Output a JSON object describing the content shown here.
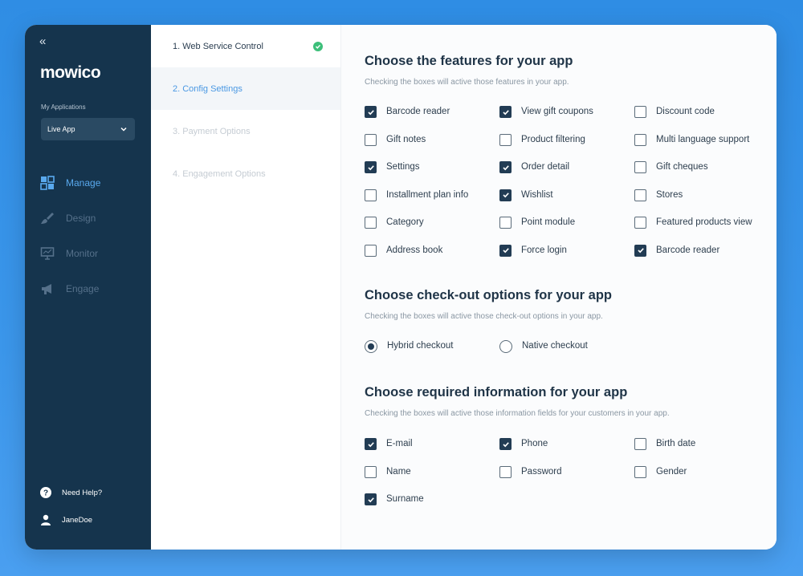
{
  "sidebar": {
    "collapse_glyph": "«",
    "logo": "mowico",
    "apps_label": "My Applications",
    "selected_app": "Live App",
    "nav": [
      {
        "label": "Manage",
        "icon": "grid-icon",
        "active": true
      },
      {
        "label": "Design",
        "icon": "brush-icon",
        "active": false
      },
      {
        "label": "Monitor",
        "icon": "monitor-icon",
        "active": false
      },
      {
        "label": "Engage",
        "icon": "megaphone-icon",
        "active": false
      }
    ],
    "help": "Need Help?",
    "user": "JaneDoe"
  },
  "steps": [
    {
      "label": "1. Web Service Control",
      "state": "done"
    },
    {
      "label": "2. Config Settings",
      "state": "active"
    },
    {
      "label": "3. Payment Options",
      "state": "pending"
    },
    {
      "label": "4. Engagement Options",
      "state": "pending"
    }
  ],
  "features": {
    "title": "Choose the features for your app",
    "subtitle": "Checking the boxes will active those features in your app.",
    "options": [
      {
        "label": "Barcode reader",
        "checked": true
      },
      {
        "label": "View gift coupons",
        "checked": true
      },
      {
        "label": "Discount code",
        "checked": false
      },
      {
        "label": "Gift notes",
        "checked": false
      },
      {
        "label": "Product filtering",
        "checked": false
      },
      {
        "label": "Multi language support",
        "checked": false
      },
      {
        "label": "Settings",
        "checked": true
      },
      {
        "label": "Order detail",
        "checked": true
      },
      {
        "label": "Gift cheques",
        "checked": false
      },
      {
        "label": "Installment plan info",
        "checked": false
      },
      {
        "label": "Wishlist",
        "checked": true
      },
      {
        "label": "Stores",
        "checked": false
      },
      {
        "label": "Category",
        "checked": false
      },
      {
        "label": "Point module",
        "checked": false
      },
      {
        "label": "Featured products view",
        "checked": false
      },
      {
        "label": "Address book",
        "checked": false
      },
      {
        "label": "Force login",
        "checked": true
      },
      {
        "label": "Barcode reader",
        "checked": true
      }
    ]
  },
  "checkout": {
    "title": "Choose check-out options for your app",
    "subtitle": "Checking the boxes will active those check-out options in your app.",
    "options": [
      {
        "label": "Hybrid checkout",
        "selected": true
      },
      {
        "label": "Native checkout",
        "selected": false
      }
    ]
  },
  "required": {
    "title": "Choose required information for your app",
    "subtitle": "Checking the boxes will active those information fields for your customers in your app.",
    "options": [
      {
        "label": "E-mail",
        "checked": true
      },
      {
        "label": "Phone",
        "checked": true
      },
      {
        "label": "Birth date",
        "checked": false
      },
      {
        "label": "Name",
        "checked": false
      },
      {
        "label": "Password",
        "checked": false
      },
      {
        "label": "Gender",
        "checked": false
      },
      {
        "label": "Surname",
        "checked": true
      }
    ]
  },
  "colors": {
    "sidebar_bg": "#15344d",
    "accent": "#4a98e3",
    "checkbox_checked": "#223c54",
    "success": "#3dbf7a"
  }
}
